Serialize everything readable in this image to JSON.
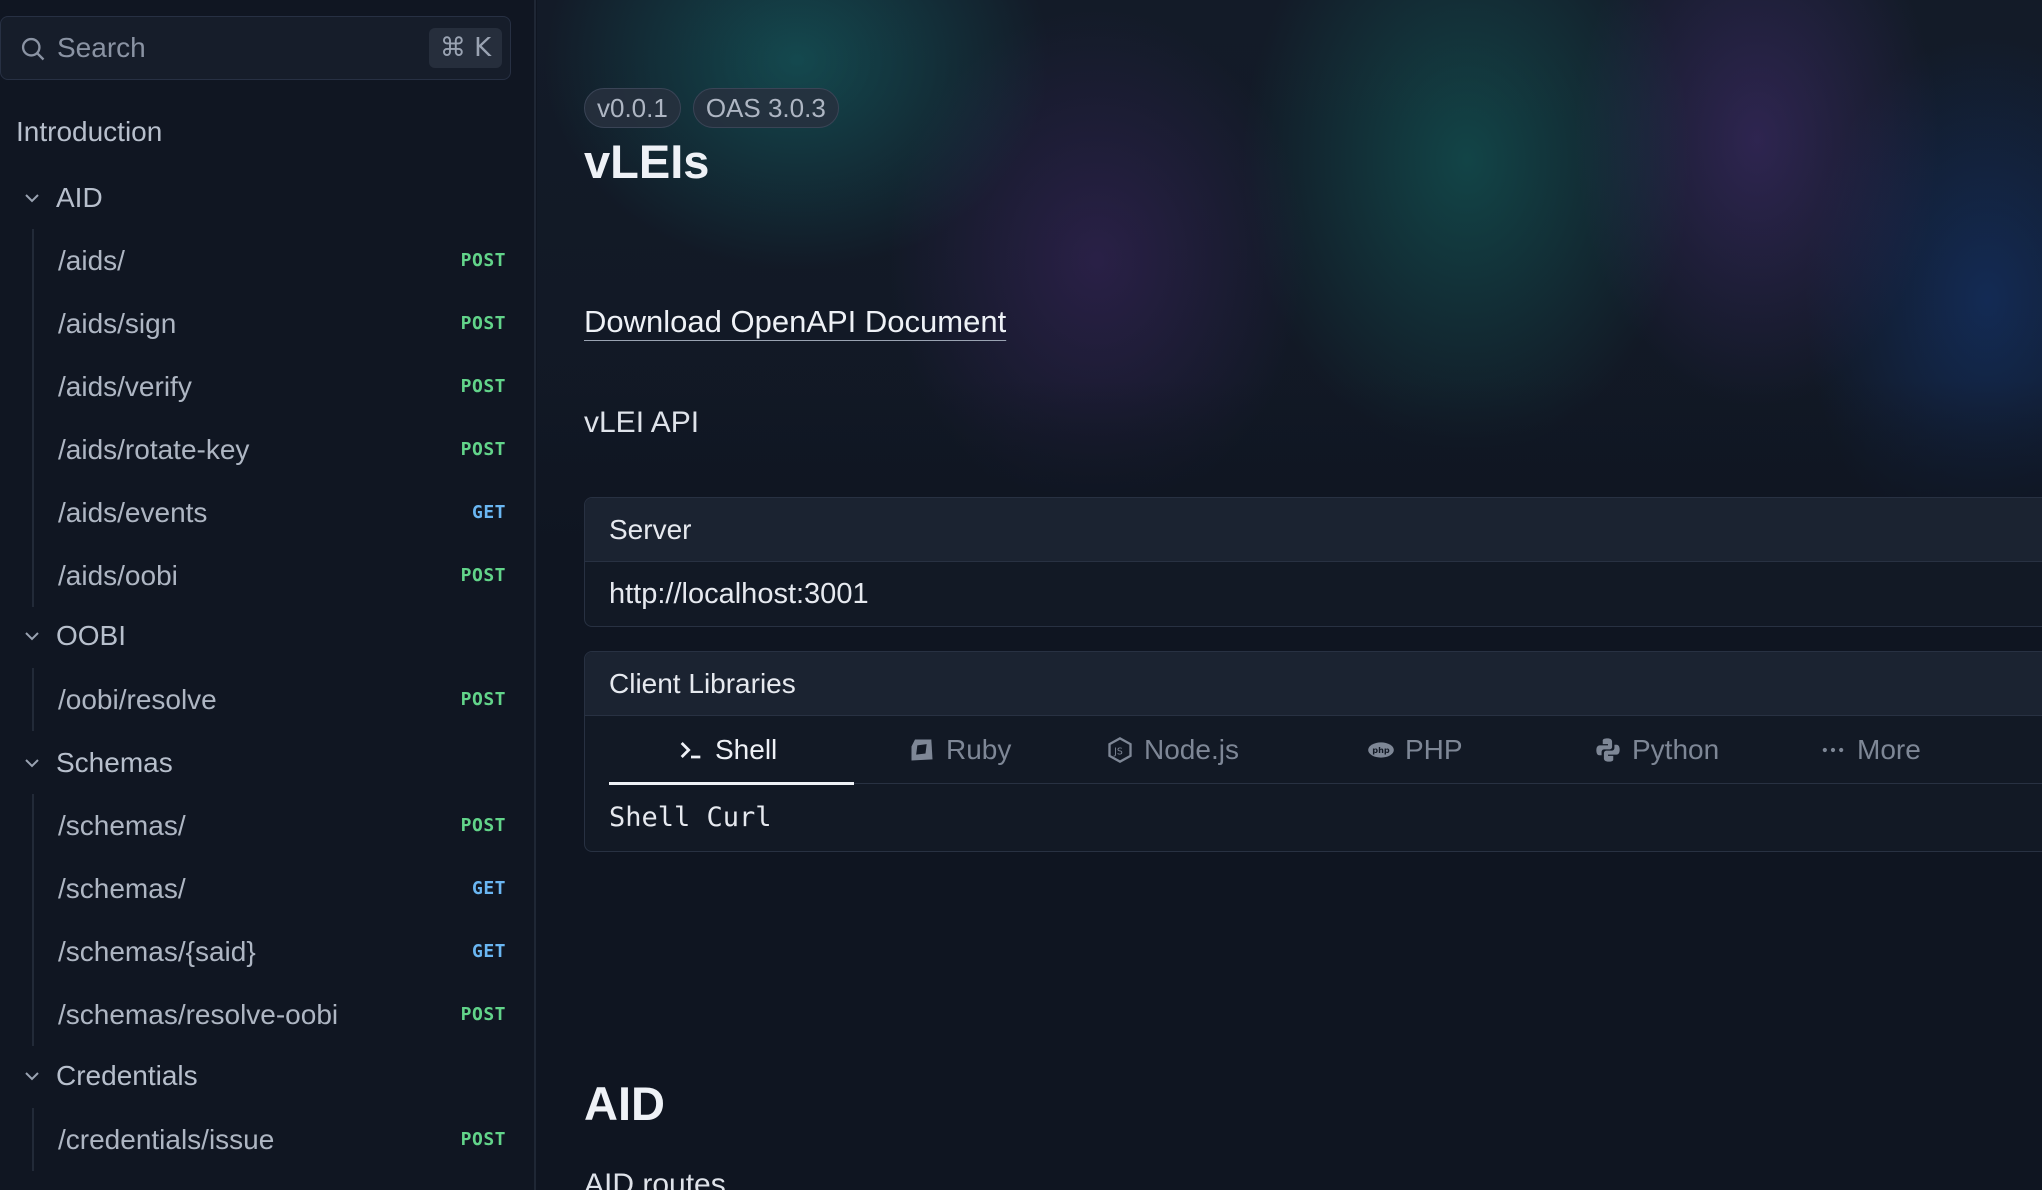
{
  "search": {
    "placeholder": "Search",
    "shortcut": "⌘ K"
  },
  "sidebar": {
    "intro": "Introduction",
    "groups": [
      {
        "label": "AID",
        "items": [
          {
            "path": "/aids/",
            "method": "POST"
          },
          {
            "path": "/aids/sign",
            "method": "POST"
          },
          {
            "path": "/aids/verify",
            "method": "POST"
          },
          {
            "path": "/aids/rotate-key",
            "method": "POST"
          },
          {
            "path": "/aids/events",
            "method": "GET"
          },
          {
            "path": "/aids/oobi",
            "method": "POST"
          }
        ]
      },
      {
        "label": "OOBI",
        "items": [
          {
            "path": "/oobi/resolve",
            "method": "POST"
          }
        ]
      },
      {
        "label": "Schemas",
        "items": [
          {
            "path": "/schemas/",
            "method": "POST"
          },
          {
            "path": "/schemas/",
            "method": "GET"
          },
          {
            "path": "/schemas/{said}",
            "method": "GET"
          },
          {
            "path": "/schemas/resolve-oobi",
            "method": "POST"
          }
        ]
      },
      {
        "label": "Credentials",
        "items": [
          {
            "path": "/credentials/issue",
            "method": "POST"
          }
        ]
      }
    ]
  },
  "main": {
    "badges": [
      "v0.0.1",
      "OAS 3.0.3"
    ],
    "title": "vLEIs",
    "download_link": "Download OpenAPI Document",
    "description": "vLEI API",
    "server": {
      "heading": "Server",
      "url": "http://localhost:3001"
    },
    "client_libraries": {
      "heading": "Client Libraries",
      "tabs": [
        "Shell",
        "Ruby",
        "Node.js",
        "PHP",
        "Python",
        "More"
      ],
      "active_tab": "Shell",
      "body": "Shell Curl"
    },
    "section": {
      "title": "AID",
      "description": "AID routes"
    }
  },
  "colors": {
    "post": "#62d48a",
    "get": "#6ab6f2",
    "background": "#0f1521"
  }
}
